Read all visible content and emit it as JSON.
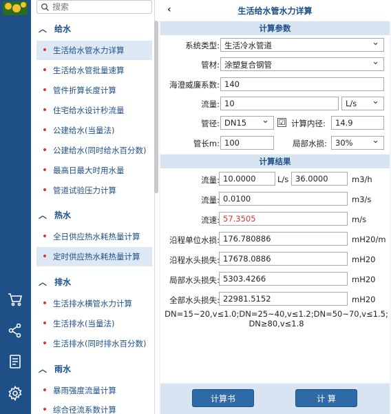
{
  "search": {
    "placeholder": "搜索"
  },
  "sidebar": {
    "sections": [
      {
        "title": "给水",
        "items": [
          "生活给水管水力详算",
          "生活给水管批量速算",
          "管件折算长度计算",
          "住宅给水设计秒流量",
          "公建给水(当量法)",
          "公建给水(同时给水百分数)",
          "最高日最大时用水量",
          "管道试验压力计算"
        ]
      },
      {
        "title": "热水",
        "items": [
          "全日供应热水耗热量计算",
          "定时供应热水耗热量计算"
        ]
      },
      {
        "title": "排水",
        "items": [
          "生活排水横管水力计算",
          "生活排水(当量法)",
          "生活排水(同时排水百分数)"
        ]
      },
      {
        "title": "雨水",
        "items": [
          "暴雨强度流量计算",
          "综合径流系数计算"
        ]
      }
    ]
  },
  "header": {
    "title": "生活给水管水力详算"
  },
  "params": {
    "heading": "计算参数",
    "system_type_label": "系统类型:",
    "system_type": "生活冷水管道",
    "material_label": "管材:",
    "material": "涂塑复合钢管",
    "hw_label": "海澄威廉系数:",
    "hw": "140",
    "flow_label": "流量:",
    "flow": "10",
    "flow_unit": "L/s",
    "dia_label": "管径:",
    "dia": "DN15",
    "check_mark": "☑",
    "inner_label": "计算内径:",
    "inner": "14.9",
    "length_label": "管长m:",
    "length": "100",
    "local_label": "局部水损:",
    "local": "30%"
  },
  "results": {
    "heading": "计算结果",
    "flow_label": "流量:",
    "flow_ls": "10.0000",
    "unit_ls": "L/s",
    "flow_m3h": "36.0000",
    "unit_m3h": "m3/h",
    "flow2_label": "流量:",
    "flow_m3s": "0.0100",
    "unit_m3s": "m3/s",
    "vel_label": "流速:",
    "vel": "57.3505",
    "unit_ms": "m/s",
    "unitloss_label": "沿程单位水损:",
    "unitloss": "176.780886",
    "unit_unitloss": "mH20/m",
    "lineloss_label": "沿程水头损失:",
    "lineloss": "17678.0886",
    "unit_lineloss": "mH20",
    "localloss_label": "局部水头损失:",
    "localloss": "5303.4266",
    "unit_localloss": "mH20",
    "totalloss_label": "全部水头损失:",
    "totalloss": "22981.5152",
    "unit_totalloss": "mH20",
    "note_line1": "DN=15~20,v≤1.0;DN=25~40,v≤1.2;DN=50~70,v≤1.5;",
    "note_line2": "DN≥80,v≤1.8"
  },
  "footer": {
    "report_button": "计算书",
    "calc_button": "计 算"
  },
  "icons": [
    "cart-icon",
    "share-icon",
    "document-icon",
    "settings-icon",
    "search-icon",
    "back-icon"
  ],
  "colors": {
    "rail": "#1e4f86",
    "accent": "#2e6aa6",
    "highlight": "#e0342c",
    "panel": "#d9e4f2"
  }
}
